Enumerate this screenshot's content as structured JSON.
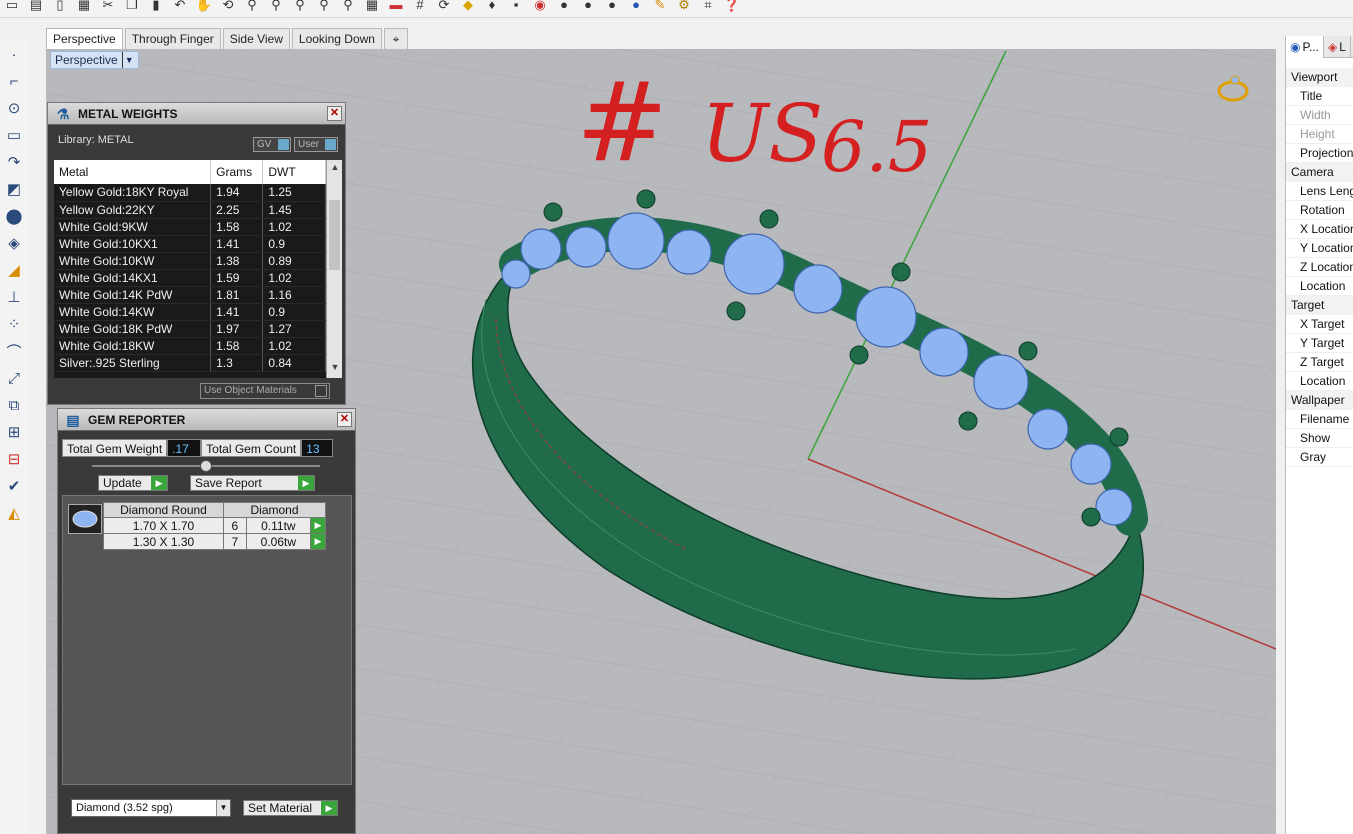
{
  "toolbar": {
    "icons": [
      "new-icon",
      "open-icon",
      "save-icon",
      "print-icon",
      "cut-icon",
      "copy-icon",
      "paste-icon",
      "undo-icon",
      "pan-icon",
      "rotate-icon",
      "zoom-icon",
      "zoom-window-icon",
      "zoom-extents-icon",
      "zoom-selected-icon",
      "zoom-out-icon",
      "layout-icon",
      "car-icon",
      "grid-icon",
      "snap-icon",
      "light-icon",
      "mesh-icon",
      "material-icon",
      "color-wheel-icon",
      "sphere-icon",
      "sphere-shaded-icon",
      "render-sphere-icon",
      "brush-icon",
      "gear-icon",
      "node-icon",
      "help-icon"
    ]
  },
  "viewport_tabs": [
    "Perspective",
    "Through Finger",
    "Side View",
    "Looking Down"
  ],
  "viewport": {
    "label": "Perspective",
    "handwritten": {
      "hash": "#",
      "us": "US",
      "size": "6.5"
    }
  },
  "metal_weights": {
    "title": "METAL WEIGHTS",
    "library_label": "Library: METAL",
    "toggle_gv": "GV",
    "toggle_user": "User",
    "columns": [
      "Metal",
      "Grams",
      "DWT"
    ],
    "rows": [
      [
        "Yellow Gold:18KY Royal",
        "1.94",
        "1.25"
      ],
      [
        "Yellow Gold:22KY",
        "2.25",
        "1.45"
      ],
      [
        "White Gold:9KW",
        "1.58",
        "1.02"
      ],
      [
        "White Gold:10KX1",
        "1.41",
        "0.9"
      ],
      [
        "White Gold:10KW",
        "1.38",
        "0.89"
      ],
      [
        "White Gold:14KX1",
        "1.59",
        "1.02"
      ],
      [
        "White Gold:14K PdW",
        "1.81",
        "1.16"
      ],
      [
        "White Gold:14KW",
        "1.41",
        "0.9"
      ],
      [
        "White Gold:18K PdW",
        "1.97",
        "1.27"
      ],
      [
        "White Gold:18KW",
        "1.58",
        "1.02"
      ],
      [
        "Silver:.925 Sterling",
        "1.3",
        "0.84"
      ]
    ],
    "use_object_materials": "Use Object Materials"
  },
  "gem_reporter": {
    "title": "GEM REPORTER",
    "total_weight_label": "Total Gem Weight",
    "total_weight_value": ".17",
    "total_count_label": "Total Gem Count",
    "total_count_value": "13",
    "update_label": "Update",
    "save_report_label": "Save Report",
    "table_header": [
      "Diamond Round",
      "Diamond"
    ],
    "rows": [
      [
        "1.70 X 1.70",
        "6",
        "0.11tw"
      ],
      [
        "1.30 X 1.30",
        "7",
        "0.06tw"
      ]
    ],
    "material_select": "Diamond    (3.52 spg)",
    "set_material_label": "Set Material"
  },
  "properties": {
    "tabs": [
      "P...",
      "L"
    ],
    "rows": [
      {
        "type": "section",
        "label": "Viewport"
      },
      {
        "type": "item",
        "label": "Title"
      },
      {
        "type": "item",
        "label": "Width",
        "dim": true
      },
      {
        "type": "item",
        "label": "Height",
        "dim": true
      },
      {
        "type": "item",
        "label": "Projection"
      },
      {
        "type": "section",
        "label": "Camera"
      },
      {
        "type": "item",
        "label": "Lens Length"
      },
      {
        "type": "item",
        "label": "Rotation"
      },
      {
        "type": "item",
        "label": "X Location"
      },
      {
        "type": "item",
        "label": "Y Location"
      },
      {
        "type": "item",
        "label": "Z Location"
      },
      {
        "type": "item",
        "label": "Location"
      },
      {
        "type": "section",
        "label": "Target"
      },
      {
        "type": "item",
        "label": "X Target"
      },
      {
        "type": "item",
        "label": "Y Target"
      },
      {
        "type": "item",
        "label": "Z Target"
      },
      {
        "type": "item",
        "label": "Location"
      },
      {
        "type": "section",
        "label": "Wallpaper"
      },
      {
        "type": "item",
        "label": "Filename"
      },
      {
        "type": "item",
        "label": "Show"
      },
      {
        "type": "item",
        "label": "Gray"
      }
    ]
  },
  "colors": {
    "ring": "#1f6b4a",
    "gem": "#8fb4f2",
    "grid_bg": "#b7b9bc",
    "axis_x": "#b33a3a",
    "axis_y": "#3aa53a",
    "handwriting": "#d42020"
  }
}
